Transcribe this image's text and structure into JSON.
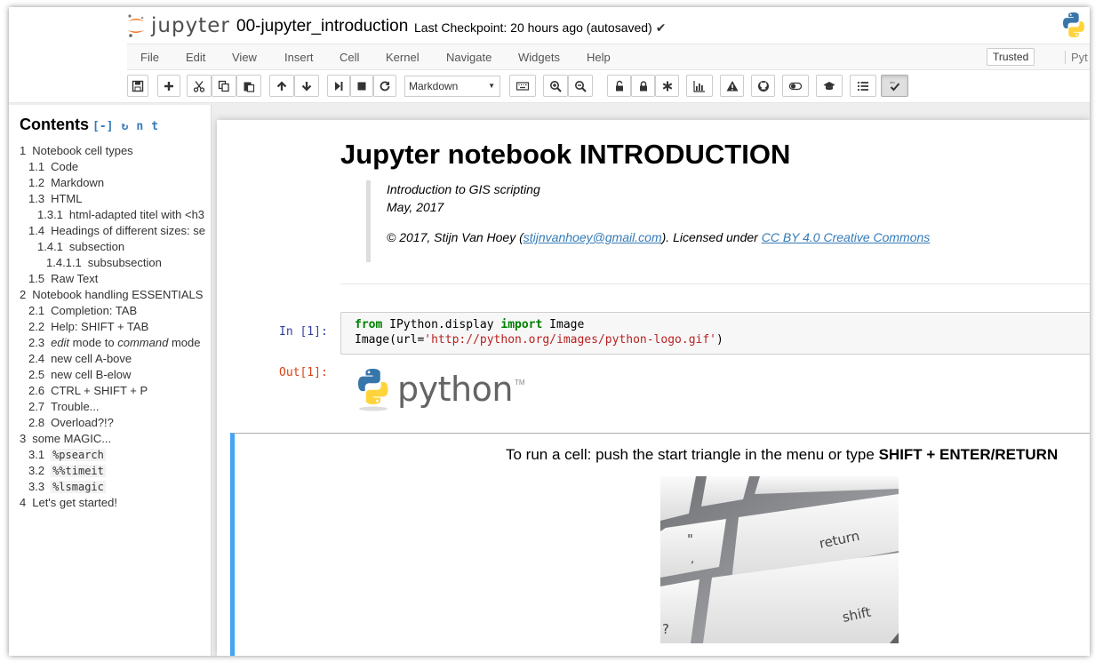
{
  "header": {
    "logo_text": "jupyter",
    "notebook_title": "00-jupyter_introduction",
    "checkpoint": "Last Checkpoint: 20 hours ago (autosaved)",
    "trusted": "Trusted",
    "kernel_name": "Pyt"
  },
  "menu": {
    "file": "File",
    "edit": "Edit",
    "view": "View",
    "insert": "Insert",
    "cell": "Cell",
    "kernel": "Kernel",
    "navigate": "Navigate",
    "widgets": "Widgets",
    "help": "Help"
  },
  "toolbar": {
    "cell_type": "Markdown",
    "icons": [
      "save-icon",
      "plus-icon",
      "cut-icon",
      "copy-icon",
      "paste-icon",
      "arrow-up-icon",
      "arrow-down-icon",
      "run-icon",
      "stop-icon",
      "restart-icon",
      "keyboard-icon",
      "zoom-in-icon",
      "zoom-out-icon",
      "unlock-icon",
      "lock-icon",
      "asterisk-icon",
      "bar-chart-icon",
      "warning-icon",
      "github-icon",
      "toggle-icon",
      "graduation-cap-icon",
      "list-icon",
      "spellcheck-icon"
    ]
  },
  "toc": {
    "title": "Contents",
    "collapse": "[-]",
    "ctrl_icons": [
      "↻",
      "n",
      "t"
    ],
    "items": [
      {
        "num": "1",
        "label": "Notebook cell types"
      },
      {
        "num": "1.1",
        "label": "Code"
      },
      {
        "num": "1.2",
        "label": "Markdown"
      },
      {
        "num": "1.3",
        "label": "HTML"
      },
      {
        "num": "1.3.1",
        "label": "html-adapted titel with <h3"
      },
      {
        "num": "1.4",
        "label": "Headings of different sizes: se"
      },
      {
        "num": "1.4.1",
        "label": "subsection"
      },
      {
        "num": "1.4.1.1",
        "label": "subsubsection"
      },
      {
        "num": "1.5",
        "label": "Raw Text"
      },
      {
        "num": "2",
        "label": "Notebook handling ESSENTIALS"
      },
      {
        "num": "2.1",
        "label": "Completion: TAB"
      },
      {
        "num": "2.2",
        "label": "Help: SHIFT + TAB"
      },
      {
        "num": "2.3",
        "label_em1": "edit",
        "label_mid": " mode to ",
        "label_em2": "command",
        "label_end": " mode"
      },
      {
        "num": "2.4",
        "label": "new cell A-bove"
      },
      {
        "num": "2.5",
        "label": "new cell B-elow"
      },
      {
        "num": "2.6",
        "label": "CTRL + SHIFT + P"
      },
      {
        "num": "2.7",
        "label": "Trouble..."
      },
      {
        "num": "2.8",
        "label": "Overload?!?"
      },
      {
        "num": "3",
        "label": "some MAGIC..."
      },
      {
        "num": "3.1",
        "code": "%psearch"
      },
      {
        "num": "3.2",
        "code": "%%timeit"
      },
      {
        "num": "3.3",
        "code": "%lsmagic"
      },
      {
        "num": "4",
        "label": "Let's get started!"
      }
    ]
  },
  "notebook": {
    "h1": "Jupyter notebook INTRODUCTION",
    "bq_line1": "Introduction to GIS scripting",
    "bq_line2": "May, 2017",
    "bq_copy_pre": "© 2017, Stijn Van Hoey (",
    "bq_email": "stijnvanhoey@gmail.com",
    "bq_copy_mid": "). Licensed under ",
    "bq_license": "CC BY 4.0 Creative Commons",
    "in_prompt": "In [1]:",
    "code": {
      "l1_kw1": "from",
      "l1_mod": " IPython.display ",
      "l1_kw2": "import",
      "l1_name": " Image",
      "l2_pre": "Image(url=",
      "l2_str": "'http://python.org/images/python-logo.gif'",
      "l2_post": ")"
    },
    "out_prompt": "Out[1]:",
    "out_logo_text": "python",
    "out_logo_tm": "TM",
    "run_text_pre": "To run a cell: push the start triangle in the menu or type ",
    "run_text_bold": "SHIFT + ENTER/RETURN",
    "key_return": "return",
    "key_shift": "shift"
  },
  "colors": {
    "selected_cell_border": "#42a5f5",
    "in_prompt": "#303f9f",
    "out_prompt": "#d84315",
    "link": "#337ab7",
    "jupyter_orange": "#f37626"
  }
}
